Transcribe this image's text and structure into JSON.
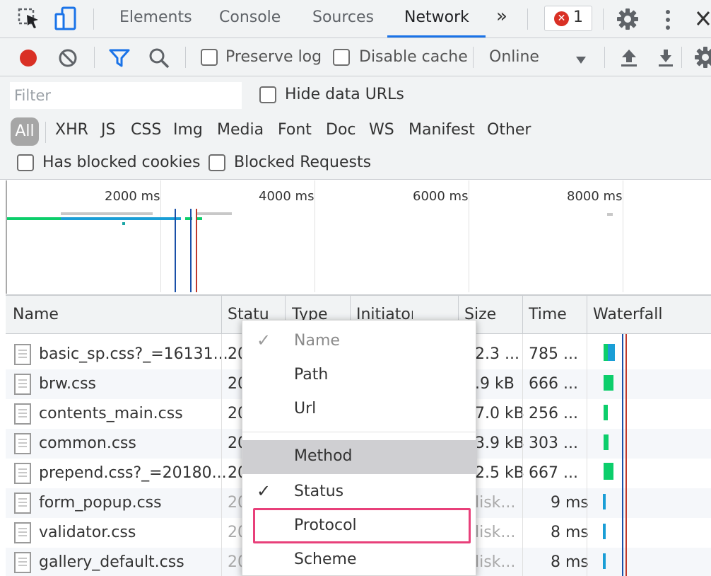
{
  "tabs": {
    "elements": "Elements",
    "console": "Console",
    "sources": "Sources",
    "network": "Network",
    "more": "»",
    "error_count": "1"
  },
  "toolbar": {
    "preserve_log": "Preserve log",
    "disable_cache": "Disable cache",
    "throttling": "Online"
  },
  "filter": {
    "placeholder": "Filter",
    "hide_data_urls": "Hide data URLs",
    "types": [
      "All",
      "XHR",
      "JS",
      "CSS",
      "Img",
      "Media",
      "Font",
      "Doc",
      "WS",
      "Manifest",
      "Other"
    ],
    "has_blocked_cookies": "Has blocked cookies",
    "blocked_requests": "Blocked Requests"
  },
  "overview": {
    "ticks": [
      "2000 ms",
      "4000 ms",
      "6000 ms",
      "8000 ms"
    ]
  },
  "columns": {
    "name": "Name",
    "status": "Status",
    "type": "Type",
    "initiator": "Initiator",
    "size": "Size",
    "time": "Time",
    "waterfall": "Waterfall"
  },
  "rows": [
    {
      "name": "basic_sp.css?_=16131...",
      "status": "20",
      "size": "2.3 ...",
      "time": "785 ..."
    },
    {
      "name": "brw.css",
      "status": "20",
      "size": ".9 kB",
      "time": "666 ..."
    },
    {
      "name": "contents_main.css",
      "status": "20",
      "size": "7.0 kB",
      "time": "256 ..."
    },
    {
      "name": "common.css",
      "status": "20",
      "size": "3.9 kB",
      "time": "303 ..."
    },
    {
      "name": "prepend.css?_=20180...",
      "status": "20",
      "size": "2.5 kB",
      "time": "667 ..."
    },
    {
      "name": "form_popup.css",
      "status": "20",
      "size": "lisk...",
      "time": "9 ms"
    },
    {
      "name": "validator.css",
      "status": "20",
      "size": "lisk...",
      "time": "8 ms"
    },
    {
      "name": "gallery_default.css",
      "status": "20",
      "size": "lisk...",
      "time": "8 ms"
    }
  ],
  "menu": {
    "name": "Name",
    "path": "Path",
    "url": "Url",
    "method": "Method",
    "status": "Status",
    "protocol": "Protocol",
    "scheme": "Scheme"
  },
  "colors": {
    "accent": "#1a73e8",
    "record": "#d93025",
    "highlight_box": "#e8407a",
    "waterfall_green": "#0cce6b",
    "waterfall_blue": "#1a9ed6"
  }
}
